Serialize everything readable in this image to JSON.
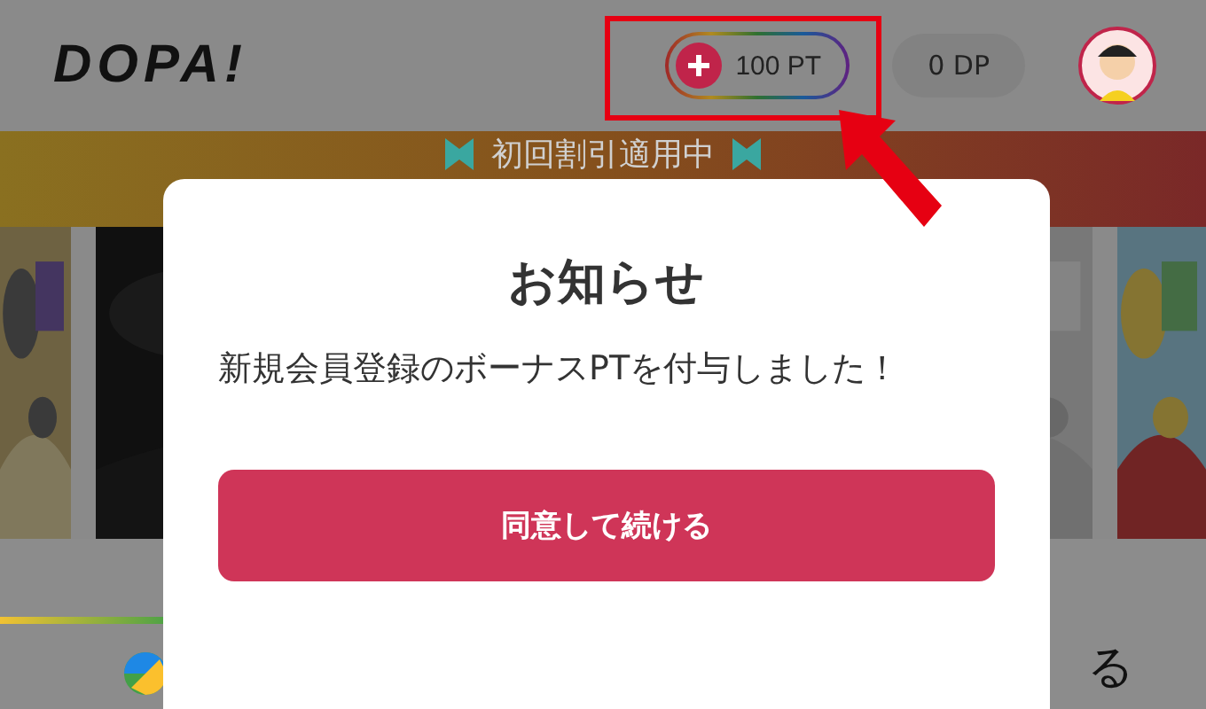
{
  "header": {
    "logo": "DOPA!",
    "points": "100 PT",
    "dp": "0 DP"
  },
  "banner": {
    "text": "初回割引適用中"
  },
  "footer": {
    "text": "る"
  },
  "dialog": {
    "title": "お知らせ",
    "message": "新規会員登録のボーナスPTを付与しました！",
    "button": "同意して続ける"
  }
}
